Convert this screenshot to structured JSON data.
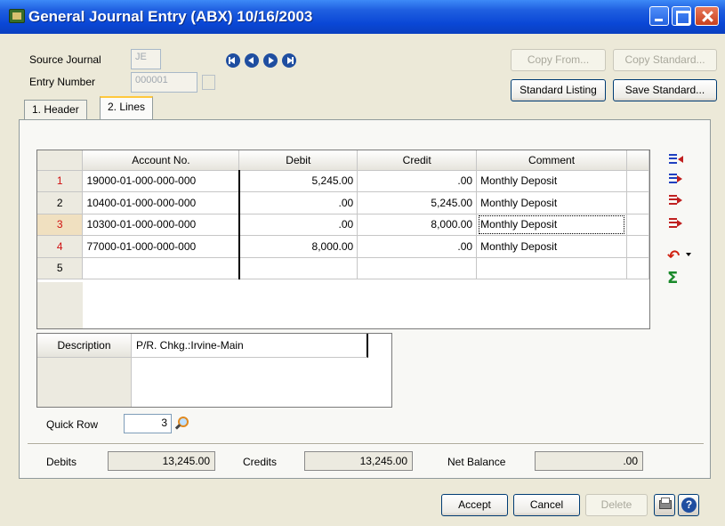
{
  "window": {
    "title": "General Journal Entry (ABX) 10/16/2003"
  },
  "header": {
    "source_journal_label": "Source Journal",
    "source_journal_value": "JE",
    "entry_number_label": "Entry Number",
    "entry_number_value": "000001"
  },
  "buttons": {
    "copy_from": "Copy From...",
    "copy_standard": "Copy Standard...",
    "standard_listing": "Standard Listing",
    "save_standard": "Save Standard...",
    "accept": "Accept",
    "cancel": "Cancel",
    "delete": "Delete"
  },
  "tabs": [
    {
      "label": "1. Header"
    },
    {
      "label": "2. Lines"
    }
  ],
  "grid": {
    "columns": [
      "Account No.",
      "Debit",
      "Credit",
      "Comment"
    ],
    "rows": [
      {
        "num": "1",
        "account": "19000-01-000-000-000",
        "debit": "5,245.00",
        "credit": ".00",
        "comment": "Monthly Deposit"
      },
      {
        "num": "2",
        "account": "10400-01-000-000-000",
        "debit": ".00",
        "credit": "5,245.00",
        "comment": "Monthly Deposit"
      },
      {
        "num": "3",
        "account": "10300-01-000-000-000",
        "debit": ".00",
        "credit": "8,000.00",
        "comment": "Monthly Deposit"
      },
      {
        "num": "4",
        "account": "77000-01-000-000-000",
        "debit": "8,000.00",
        "credit": ".00",
        "comment": "Monthly Deposit"
      },
      {
        "num": "5",
        "account": "",
        "debit": "",
        "credit": "",
        "comment": ""
      }
    ]
  },
  "description": {
    "label": "Description",
    "value": "P/R. Chkg.:Irvine-Main"
  },
  "quick_row": {
    "label": "Quick Row",
    "value": "3"
  },
  "totals": {
    "debits_label": "Debits",
    "debits_value": "13,245.00",
    "credits_label": "Credits",
    "credits_value": "13,245.00",
    "net_label": "Net Balance",
    "net_value": ".00"
  },
  "icons": [
    "insert-line-icon",
    "append-line-icon",
    "delete-line-icon",
    "delete-all-lines-icon",
    "undo-icon",
    "sum-icon",
    "lookup-icon",
    "print-icon",
    "help-icon"
  ]
}
